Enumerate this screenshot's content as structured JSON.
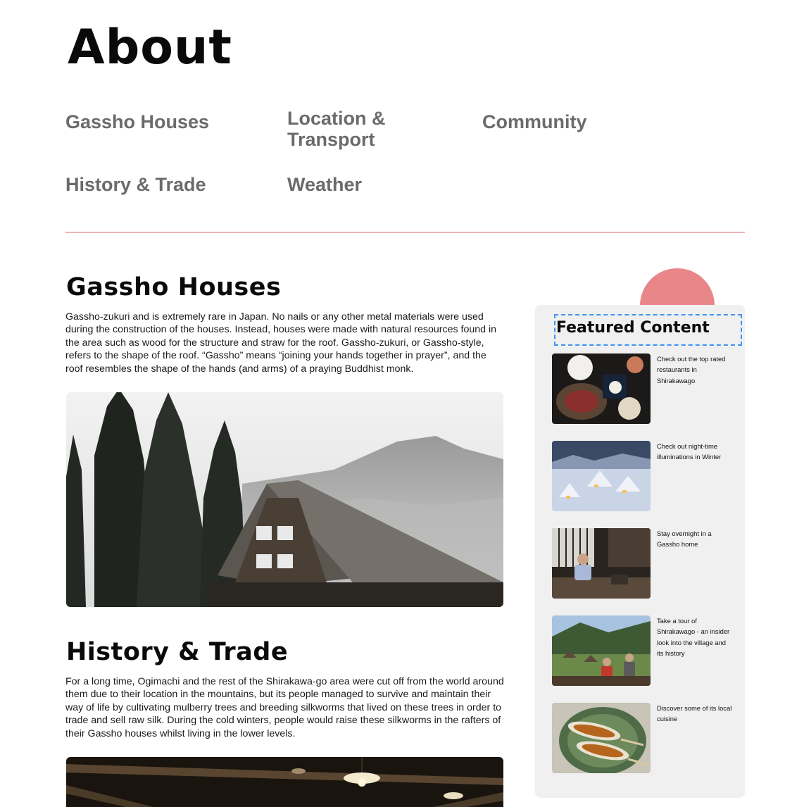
{
  "page": {
    "title": "About"
  },
  "nav": {
    "items": [
      {
        "label": "Gassho Houses"
      },
      {
        "label": "Location & Transport"
      },
      {
        "label": "Community"
      },
      {
        "label": "History & Trade"
      },
      {
        "label": "Weather"
      }
    ]
  },
  "sections": [
    {
      "heading": "Gassho Houses",
      "body": "Gassho-zukuri and is extremely rare in Japan. No nails or any other metal materials were used during the construction of the houses. Instead, houses were made with natural resources found in the area such as wood for the structure and straw for the roof. Gassho-zukuri, or Gassho-style, refers to the shape of the roof. “Gassho” means “joining your hands together in prayer”, and the roof resembles the shape of the hands (and arms) of a praying Buddhist monk."
    },
    {
      "heading": "History & Trade",
      "body": "For a long time, Ogimachi and the rest of the Shirakawa-go area were cut off from the world around them due to their location in the mountains, but its people managed to survive and maintain their way of life by cultivating mulberry trees and breeding silkworms that lived on these trees in order to trade and sell raw silk. During the cold winters, people would raise these silkworms in the rafters of their Gassho houses whilst living in the lower levels."
    }
  ],
  "sidebar": {
    "title": "Featured Content",
    "items": [
      {
        "text": "Check out the top rated restaurants in Shirakawago"
      },
      {
        "text": "Check out night-time illuminations in Winter"
      },
      {
        "text": "Stay overnight in a Gassho home"
      },
      {
        "text": "Take a tour of Shirakawago - an insider look into the village and its history"
      },
      {
        "text": "Discover some of its local cuisine"
      }
    ]
  },
  "colors": {
    "accent": "#e8868a",
    "divider": "#f2b3b6",
    "sidebar_bg": "#f0f0f0",
    "nav_text": "#6b6b6b",
    "selection": "#3e95f0"
  }
}
